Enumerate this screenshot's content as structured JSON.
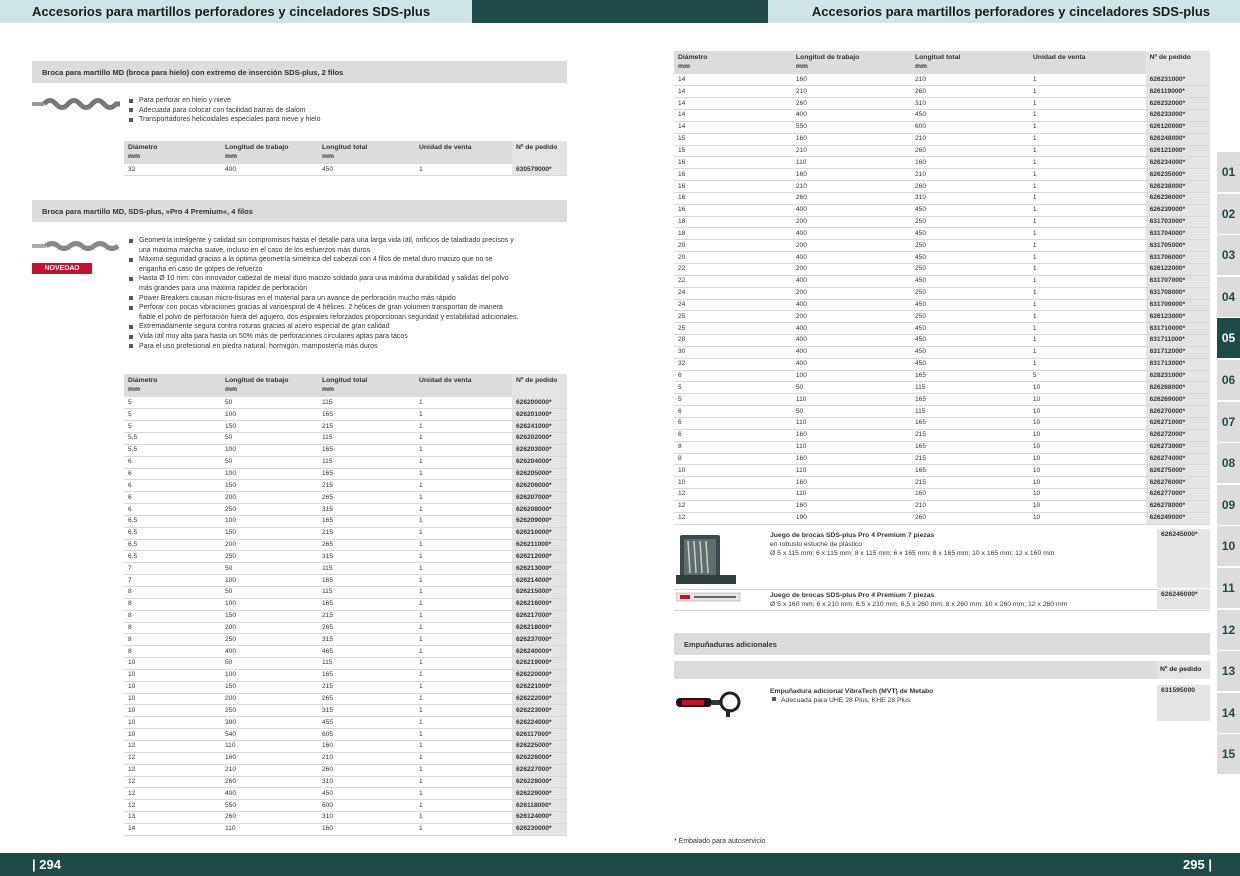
{
  "header": {
    "left_title": "Accesorios para martillos perforadores y cinceladores SDS-plus",
    "right_title": "Accesorios para martillos perforadores y cinceladores SDS-plus"
  },
  "footer": {
    "left_page": "| 294",
    "right_page": "295 |"
  },
  "section1": {
    "title": "Broca para martillo MD (broca para hielo) con extremo de inserción SDS-plus, 2 filos",
    "bullets": [
      "Para perforar en hielo y nieve",
      "Adecuada para colocar con facilidad barras de slalom",
      "Transportadores helicoidales especiales para nieve y hielo"
    ],
    "headers": [
      "Diámetro\nmm",
      "Longitud de trabajo\nmm",
      "Longitud total\nmm",
      "Unidad de venta",
      "Nº de pedido"
    ],
    "rows": [
      [
        "32",
        "400",
        "450",
        "1",
        "630579000*"
      ]
    ]
  },
  "section2": {
    "title": "Broca para martillo MD, SDS-plus, »Pro 4 Premium«, 4 filos",
    "badge": "NOVEDAD",
    "bullets": [
      "Geometría inteligente y calidad sin compromisos hasta el detalle para una larga vida útil, orificios de taladrado precisos y una máxima marcha suave, incluso en el caso de los esfuerzos más duros",
      "Máxima seguridad gracias a la óptima geometría simétrica del cabezal con 4 filos de metal duro macizo que no se enganha en caso de golpes de refuerzo",
      "Hasta Ø 10 mm: con innovador cabezal de metal duro macizo soldado para una máxima durabilidad y salidas del polvo más grandes para una máxima rapidez de perforación",
      "Power Breakers causan micro-fisuras en el material para un avance de perforación mucho más rápido",
      "Perforar con pocas vibraciones gracias al varioespiral de 4 hélices. 2 hélices de gran volumen transportan de manera fiable el polvo de perforación fuera del agujero, dos espirales reforzados proporcionan seguridad y estabilidad adicionales.",
      "Extremadamente segura contra roturas gracias al acero especial de gran calidad",
      "Vida útil muy alta para hasta un 50% más de perforaciones circulares aptas para tacos",
      "Para el uso profesional en piedra natural, hormigón, mampostería más duros"
    ],
    "headers": [
      "Diámetro\nmm",
      "Longitud de trabajo\nmm",
      "Longitud total\nmm",
      "Unidad de venta",
      "Nº de pedido"
    ],
    "rows": [
      [
        "5",
        "50",
        "115",
        "1",
        "626200000*"
      ],
      [
        "5",
        "100",
        "165",
        "1",
        "626201000*"
      ],
      [
        "5",
        "150",
        "215",
        "1",
        "626241000*"
      ],
      [
        "5,5",
        "50",
        "115",
        "1",
        "626202000*"
      ],
      [
        "5,5",
        "100",
        "165",
        "1",
        "626203000*"
      ],
      [
        "6",
        "50",
        "115",
        "1",
        "626204000*"
      ],
      [
        "6",
        "100",
        "165",
        "1",
        "626205000*"
      ],
      [
        "6",
        "150",
        "215",
        "1",
        "626206000*"
      ],
      [
        "6",
        "200",
        "265",
        "1",
        "626207000*"
      ],
      [
        "6",
        "250",
        "315",
        "1",
        "626208000*"
      ],
      [
        "6,5",
        "100",
        "165",
        "1",
        "626209000*"
      ],
      [
        "6,5",
        "150",
        "215",
        "1",
        "626210000*"
      ],
      [
        "6,5",
        "200",
        "265",
        "1",
        "626211000*"
      ],
      [
        "6,5",
        "250",
        "315",
        "1",
        "626212000*"
      ],
      [
        "7",
        "50",
        "115",
        "1",
        "626213000*"
      ],
      [
        "7",
        "100",
        "165",
        "1",
        "626214000*"
      ],
      [
        "8",
        "50",
        "115",
        "1",
        "626215000*"
      ],
      [
        "8",
        "100",
        "165",
        "1",
        "626216000*"
      ],
      [
        "8",
        "150",
        "215",
        "1",
        "626217000*"
      ],
      [
        "8",
        "200",
        "265",
        "1",
        "626218000*"
      ],
      [
        "8",
        "250",
        "315",
        "1",
        "626237000*"
      ],
      [
        "8",
        "400",
        "465",
        "1",
        "626240000*"
      ],
      [
        "10",
        "50",
        "115",
        "1",
        "626219000*"
      ],
      [
        "10",
        "100",
        "165",
        "1",
        "626220000*"
      ],
      [
        "10",
        "150",
        "215",
        "1",
        "626221000*"
      ],
      [
        "10",
        "200",
        "265",
        "1",
        "626222000*"
      ],
      [
        "10",
        "250",
        "315",
        "1",
        "626223000*"
      ],
      [
        "10",
        "390",
        "455",
        "1",
        "626224000*"
      ],
      [
        "10",
        "540",
        "605",
        "1",
        "626117000*"
      ],
      [
        "12",
        "110",
        "160",
        "1",
        "626225000*"
      ],
      [
        "12",
        "160",
        "210",
        "1",
        "626226000*"
      ],
      [
        "12",
        "210",
        "260",
        "1",
        "626227000*"
      ],
      [
        "12",
        "260",
        "310",
        "1",
        "626228000*"
      ],
      [
        "12",
        "400",
        "450",
        "1",
        "626229000*"
      ],
      [
        "12",
        "550",
        "600",
        "1",
        "626118000*"
      ],
      [
        "13",
        "260",
        "310",
        "1",
        "626124000*"
      ],
      [
        "14",
        "110",
        "160",
        "1",
        "626230000*"
      ]
    ]
  },
  "right_table": {
    "headers": [
      "Diámetro\nmm",
      "Longitud de trabajo\nmm",
      "Longitud total\nmm",
      "Unidad de venta",
      "Nº de pedido"
    ],
    "rows": [
      [
        "14",
        "160",
        "210",
        "1",
        "626231000*"
      ],
      [
        "14",
        "210",
        "260",
        "1",
        "626119000*"
      ],
      [
        "14",
        "260",
        "310",
        "1",
        "626232000*"
      ],
      [
        "14",
        "400",
        "450",
        "1",
        "626233000*"
      ],
      [
        "14",
        "550",
        "600",
        "1",
        "626120000*"
      ],
      [
        "15",
        "160",
        "210",
        "1",
        "626248000*"
      ],
      [
        "15",
        "210",
        "260",
        "1",
        "626121000*"
      ],
      [
        "16",
        "110",
        "160",
        "1",
        "626234000*"
      ],
      [
        "16",
        "160",
        "210",
        "1",
        "626235000*"
      ],
      [
        "16",
        "210",
        "260",
        "1",
        "626238000*"
      ],
      [
        "16",
        "260",
        "310",
        "1",
        "626236000*"
      ],
      [
        "16",
        "400",
        "450",
        "1",
        "626239000*"
      ],
      [
        "18",
        "200",
        "250",
        "1",
        "631703000*"
      ],
      [
        "18",
        "400",
        "450",
        "1",
        "631704000*"
      ],
      [
        "20",
        "200",
        "250",
        "1",
        "631705000*"
      ],
      [
        "20",
        "400",
        "450",
        "1",
        "631706000*"
      ],
      [
        "22",
        "200",
        "250",
        "1",
        "626122000*"
      ],
      [
        "22",
        "400",
        "450",
        "1",
        "631707000*"
      ],
      [
        "24",
        "200",
        "250",
        "1",
        "631708000*"
      ],
      [
        "24",
        "400",
        "450",
        "1",
        "631709000*"
      ],
      [
        "25",
        "200",
        "250",
        "1",
        "626123000*"
      ],
      [
        "25",
        "400",
        "450",
        "1",
        "631710000*"
      ],
      [
        "28",
        "400",
        "450",
        "1",
        "631711000*"
      ],
      [
        "30",
        "400",
        "450",
        "1",
        "631712000*"
      ],
      [
        "32",
        "400",
        "450",
        "1",
        "631713000*"
      ],
      [
        "6",
        "100",
        "165",
        "5",
        "628231000*"
      ],
      [
        "5",
        "50",
        "115",
        "10",
        "626268000*"
      ],
      [
        "5",
        "110",
        "165",
        "10",
        "626269000*"
      ],
      [
        "6",
        "50",
        "115",
        "10",
        "626270000*"
      ],
      [
        "6",
        "110",
        "165",
        "10",
        "626271000*"
      ],
      [
        "6",
        "160",
        "215",
        "10",
        "626272000*"
      ],
      [
        "8",
        "110",
        "165",
        "10",
        "626273000*"
      ],
      [
        "8",
        "160",
        "215",
        "10",
        "626274000*"
      ],
      [
        "10",
        "110",
        "165",
        "10",
        "626275000*"
      ],
      [
        "10",
        "160",
        "215",
        "10",
        "626276000*"
      ],
      [
        "12",
        "110",
        "160",
        "10",
        "626277000*"
      ],
      [
        "12",
        "160",
        "210",
        "10",
        "626278000*"
      ],
      [
        "12",
        "190",
        "260",
        "10",
        "626249000*"
      ]
    ]
  },
  "kits": [
    {
      "title": "Juego de brocas SDS-plus Pro 4 Premium 7 piezas",
      "line1": "en robusto estuche de plástico",
      "line2": "Ø 5 x 115 mm; 6 x 115 mm; 8 x 115 mm; 6 x 165 mm; 8 x 165 mm; 10 x 165 mm; 12 x 160 mm",
      "code": "626245000*"
    },
    {
      "title": "Juego de brocas SDS-plus Pro 4 Premium 7 piezas",
      "line1": "Ø 5 x 160 mm; 6 x 210 mm; 6,5 x 210 mm; 6,5 x 260 mm; 8 x 260 mm; 10 x 260 mm; 12 x 260 mm",
      "code": "626246000*"
    }
  ],
  "section3": {
    "title": "Empuñaduras adicionales",
    "header_code": "Nº de pedido",
    "item_title": "Empuñadura adicional VibraTech (MVT) de Metabo",
    "item_bullet": "Adecuada para UHE 28 Plus, KHE 28 Plus",
    "code": "631595000"
  },
  "footnote": "* Embalado para autoservicio",
  "tabs": [
    "01",
    "02",
    "03",
    "04",
    "05",
    "06",
    "07",
    "08",
    "09",
    "10",
    "11",
    "12",
    "13",
    "14",
    "15"
  ],
  "active_tab": "05",
  "colors": {
    "dark_green": "#1e4a47",
    "light_teal": "#cfe4e4",
    "badge_red": "#c8102e",
    "gray": "#dcdcdc"
  }
}
